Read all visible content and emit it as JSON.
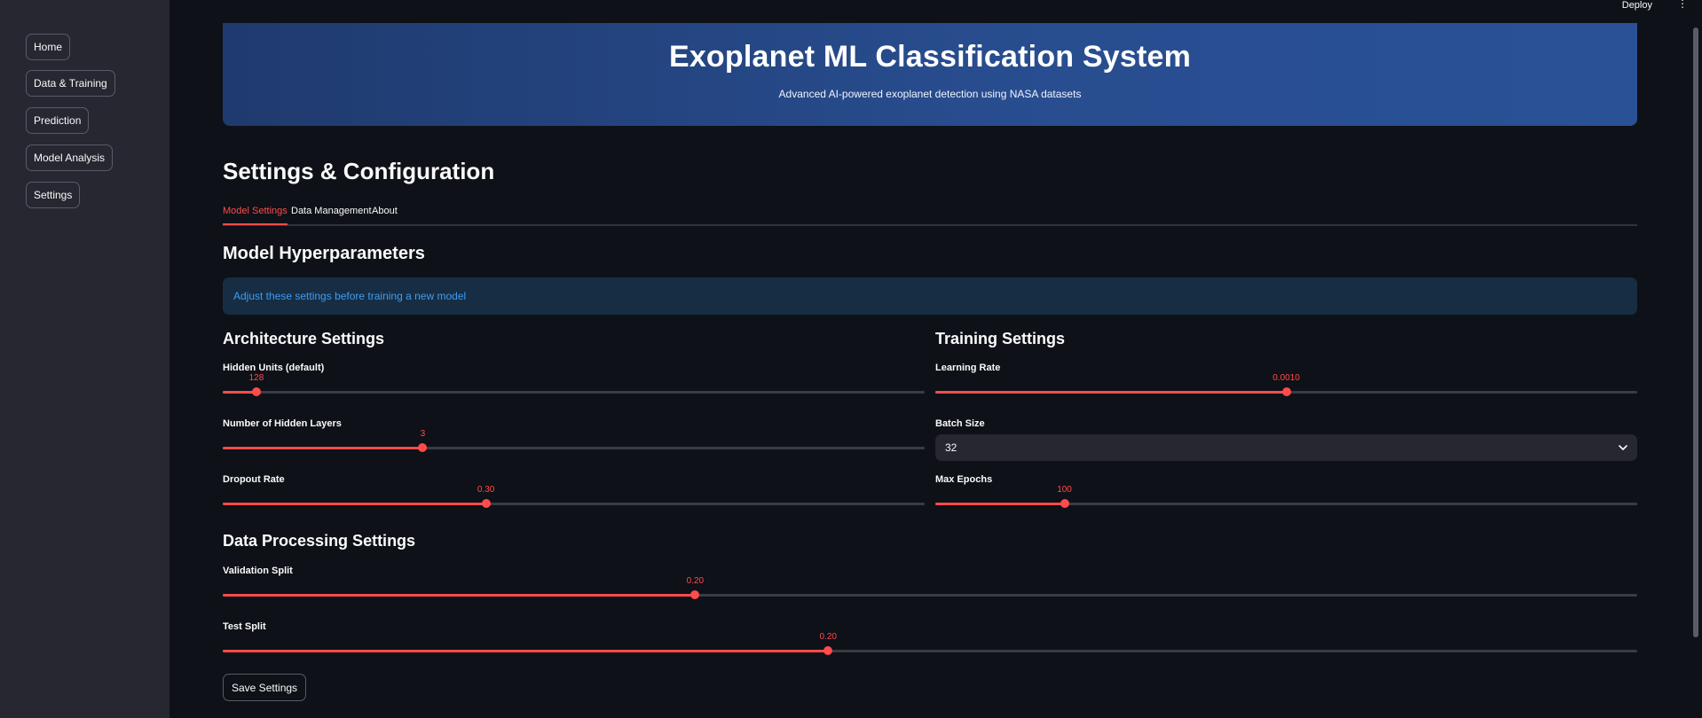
{
  "sidebar": {
    "items": [
      {
        "label": "Home"
      },
      {
        "label": "Data & Training"
      },
      {
        "label": "Prediction"
      },
      {
        "label": "Model Analysis"
      },
      {
        "label": "Settings"
      }
    ]
  },
  "topbar": {
    "deploy_label": "Deploy",
    "menu_icon": "⋮"
  },
  "hero": {
    "title": "Exoplanet ML Classification System",
    "subtitle": "Advanced AI-powered exoplanet detection using NASA datasets"
  },
  "page": {
    "title": "Settings & Configuration"
  },
  "tabs": [
    {
      "label": "Model Settings",
      "active": true
    },
    {
      "label": "Data Management",
      "active": false
    },
    {
      "label": "About",
      "active": false
    }
  ],
  "section": {
    "hyperparams_title": "Model Hyperparameters",
    "info_text": "Adjust these settings before training a new model",
    "architecture_title": "Architecture Settings",
    "training_title": "Training Settings",
    "data_processing_title": "Data Processing Settings"
  },
  "architecture": {
    "hidden_units": {
      "label": "Hidden Units (default)",
      "value": "128",
      "fraction": 0.048
    },
    "hidden_layers": {
      "label": "Number of Hidden Layers",
      "value": "3",
      "fraction": 0.285
    },
    "dropout": {
      "label": "Dropout Rate",
      "value": "0.30",
      "fraction": 0.375
    }
  },
  "training": {
    "learning_rate": {
      "label": "Learning Rate",
      "value": "0.0010",
      "fraction": 0.5
    },
    "batch_size": {
      "label": "Batch Size",
      "value": "32"
    },
    "max_epochs": {
      "label": "Max Epochs",
      "value": "100",
      "fraction": 0.184
    }
  },
  "data_processing": {
    "validation_split": {
      "label": "Validation Split",
      "value": "0.20",
      "fraction": 0.334
    },
    "test_split": {
      "label": "Test Split",
      "value": "0.20",
      "fraction": 0.428
    }
  },
  "actions": {
    "save_label": "Save Settings"
  },
  "colors": {
    "accent": "#ff4b4b",
    "background": "#0e1117",
    "sidebar": "#262730",
    "info_text": "#3d9df3",
    "info_bg": "#172d43",
    "hero_gradient_start": "#1f3a6e",
    "hero_gradient_end": "#2a5196"
  }
}
